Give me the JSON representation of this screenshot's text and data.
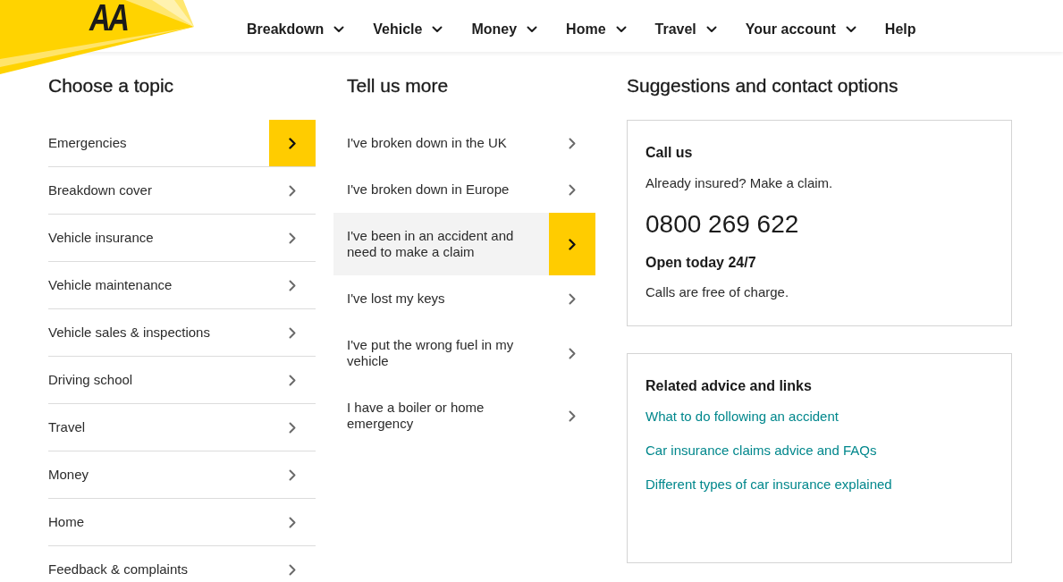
{
  "header": {
    "logo": {
      "text": "AA"
    },
    "nav": [
      {
        "label": "Breakdown",
        "has_menu": true
      },
      {
        "label": "Vehicle",
        "has_menu": true
      },
      {
        "label": "Money",
        "has_menu": true
      },
      {
        "label": "Home",
        "has_menu": true
      },
      {
        "label": "Travel",
        "has_menu": true
      },
      {
        "label": "Your account",
        "has_menu": true
      },
      {
        "label": "Help",
        "has_menu": false
      }
    ]
  },
  "topics": {
    "heading": "Choose a topic",
    "items": [
      {
        "label": "Emergencies",
        "selected": true
      },
      {
        "label": "Breakdown cover",
        "selected": false
      },
      {
        "label": "Vehicle insurance",
        "selected": false
      },
      {
        "label": "Vehicle maintenance",
        "selected": false
      },
      {
        "label": "Vehicle sales & inspections",
        "selected": false
      },
      {
        "label": "Driving school",
        "selected": false
      },
      {
        "label": "Travel",
        "selected": false
      },
      {
        "label": "Money",
        "selected": false
      },
      {
        "label": "Home",
        "selected": false
      },
      {
        "label": "Feedback & complaints",
        "selected": false
      }
    ]
  },
  "details": {
    "heading": "Tell us more",
    "items": [
      {
        "label": "I've broken down in the UK",
        "selected": false
      },
      {
        "label": "I've broken down in Europe",
        "selected": false
      },
      {
        "label": "I've been in an accident and need to make a claim",
        "selected": true
      },
      {
        "label": "I've lost my keys",
        "selected": false
      },
      {
        "label": "I've put the wrong fuel in my vehicle",
        "selected": false
      },
      {
        "label": "I have a boiler or home emergency",
        "selected": false
      }
    ]
  },
  "suggestions": {
    "heading": "Suggestions and contact options",
    "cards": [
      {
        "kind": "contact",
        "title": "Call us",
        "intro": "Already insured? Make a claim.",
        "phone": "0800 269 622",
        "hours": "Open today 24/7",
        "note": "Calls are free of charge."
      },
      {
        "kind": "links",
        "title": "Related advice and links",
        "links": [
          "What to do following an accident",
          "Car insurance claims advice and FAQs",
          "Different types of car insurance explained"
        ]
      }
    ]
  }
}
